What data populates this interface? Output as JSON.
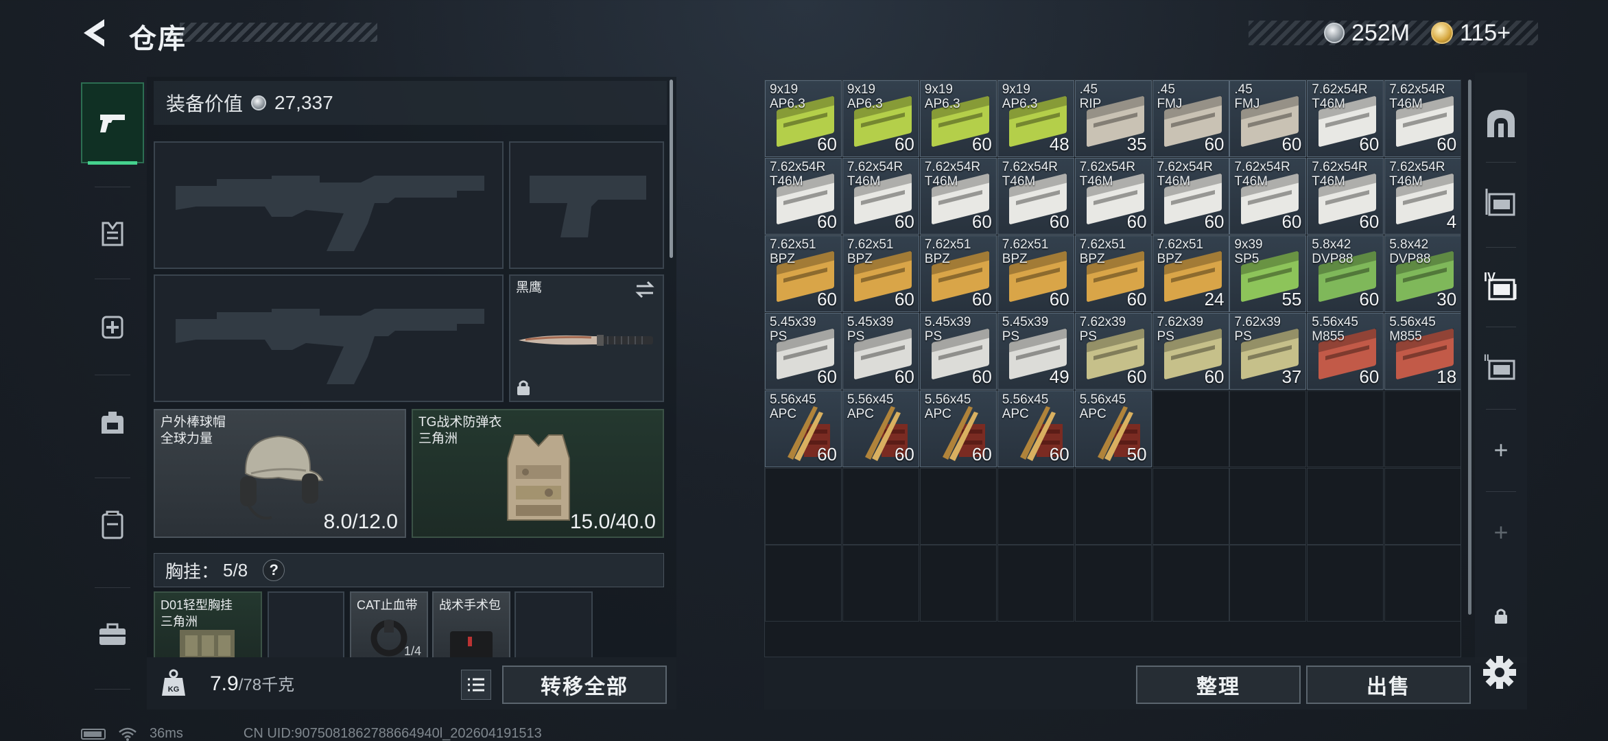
{
  "header": {
    "title": "仓库",
    "silver": "252M",
    "gold": "115+",
    "back_icon": "chevron-left-icon"
  },
  "categories": [
    {
      "name": "pistol",
      "icon": "pistol-icon",
      "active": true
    },
    {
      "name": "armor",
      "icon": "armor-icon",
      "active": false
    },
    {
      "name": "medical",
      "icon": "medkit-icon",
      "active": false
    },
    {
      "name": "backpack",
      "icon": "backpack-icon",
      "active": false
    },
    {
      "name": "container",
      "icon": "container-icon",
      "active": false
    },
    {
      "name": "toolbox",
      "icon": "toolbox-icon",
      "active": false
    }
  ],
  "equipment": {
    "value_label": "装备价值",
    "value": "27,337",
    "knife": {
      "name": "黑鹰"
    },
    "helmet": {
      "name": "户外棒球帽",
      "sub": "全球力量",
      "durability": "8.0/12.0"
    },
    "vest": {
      "name": "TG战术防弹衣",
      "sub": "三角洲",
      "durability": "15.0/40.0"
    },
    "chest": {
      "label": "胸挂：",
      "count": "5/8",
      "help": "?"
    },
    "chest_items": [
      {
        "name": "D01轻型胸挂",
        "sub": "三角洲"
      },
      {
        "name": ""
      },
      {
        "name": "CAT止血带",
        "count": "1/4"
      },
      {
        "name": "战术手术包"
      },
      {
        "name": ""
      }
    ],
    "weight_value": "7.9",
    "weight_max": "/78千克",
    "transfer_all": "转移全部"
  },
  "stash": {
    "columns": 9,
    "rows": 7,
    "items": [
      {
        "cal1": "9x19",
        "cal2": "AP6.3",
        "qty": "60",
        "color": "#b4cf4a"
      },
      {
        "cal1": "9x19",
        "cal2": "AP6.3",
        "qty": "60",
        "color": "#b4cf4a"
      },
      {
        "cal1": "9x19",
        "cal2": "AP6.3",
        "qty": "60",
        "color": "#b4cf4a"
      },
      {
        "cal1": "9x19",
        "cal2": "AP6.3",
        "qty": "48",
        "color": "#b4cf4a"
      },
      {
        "cal1": ".45",
        "cal2": "RIP",
        "qty": "35",
        "color": "#c9c2b4"
      },
      {
        "cal1": ".45",
        "cal2": "FMJ",
        "qty": "60",
        "color": "#c9c2b4"
      },
      {
        "cal1": ".45",
        "cal2": "FMJ",
        "qty": "60",
        "color": "#c9c2b4"
      },
      {
        "cal1": "7.62x54R",
        "cal2": "T46M",
        "qty": "60",
        "color": "#e8e8e4"
      },
      {
        "cal1": "7.62x54R",
        "cal2": "T46M",
        "qty": "60",
        "color": "#e8e8e4"
      },
      {
        "cal1": "7.62x54R",
        "cal2": "T46M",
        "qty": "60",
        "color": "#e8e8e4"
      },
      {
        "cal1": "7.62x54R",
        "cal2": "T46M",
        "qty": "60",
        "color": "#e8e8e4"
      },
      {
        "cal1": "7.62x54R",
        "cal2": "T46M",
        "qty": "60",
        "color": "#e8e8e4"
      },
      {
        "cal1": "7.62x54R",
        "cal2": "T46M",
        "qty": "60",
        "color": "#e8e8e4"
      },
      {
        "cal1": "7.62x54R",
        "cal2": "T46M",
        "qty": "60",
        "color": "#e8e8e4"
      },
      {
        "cal1": "7.62x54R",
        "cal2": "T46M",
        "qty": "60",
        "color": "#e8e8e4"
      },
      {
        "cal1": "7.62x54R",
        "cal2": "T46M",
        "qty": "60",
        "color": "#e8e8e4"
      },
      {
        "cal1": "7.62x54R",
        "cal2": "T46M",
        "qty": "60",
        "color": "#e8e8e4"
      },
      {
        "cal1": "7.62x54R",
        "cal2": "T46M",
        "qty": "4",
        "color": "#e8e8e4"
      },
      {
        "cal1": "7.62x51",
        "cal2": "BPZ",
        "qty": "60",
        "color": "#d9a548"
      },
      {
        "cal1": "7.62x51",
        "cal2": "BPZ",
        "qty": "60",
        "color": "#d9a548"
      },
      {
        "cal1": "7.62x51",
        "cal2": "BPZ",
        "qty": "60",
        "color": "#d9a548"
      },
      {
        "cal1": "7.62x51",
        "cal2": "BPZ",
        "qty": "60",
        "color": "#d9a548"
      },
      {
        "cal1": "7.62x51",
        "cal2": "BPZ",
        "qty": "60",
        "color": "#d9a548"
      },
      {
        "cal1": "7.62x51",
        "cal2": "BPZ",
        "qty": "24",
        "color": "#d9a548"
      },
      {
        "cal1": "9x39",
        "cal2": "SP5",
        "qty": "55",
        "color": "#8dc45a"
      },
      {
        "cal1": "5.8x42",
        "cal2": "DVP88",
        "qty": "60",
        "color": "#7fb85a"
      },
      {
        "cal1": "5.8x42",
        "cal2": "DVP88",
        "qty": "30",
        "color": "#7fb85a"
      },
      {
        "cal1": "5.45x39",
        "cal2": "PS",
        "qty": "60",
        "color": "#dcdcd8"
      },
      {
        "cal1": "5.45x39",
        "cal2": "PS",
        "qty": "60",
        "color": "#dcdcd8"
      },
      {
        "cal1": "5.45x39",
        "cal2": "PS",
        "qty": "60",
        "color": "#dcdcd8"
      },
      {
        "cal1": "5.45x39",
        "cal2": "PS",
        "qty": "49",
        "color": "#dcdcd8"
      },
      {
        "cal1": "7.62x39",
        "cal2": "PS",
        "qty": "60",
        "color": "#c6c08a"
      },
      {
        "cal1": "7.62x39",
        "cal2": "PS",
        "qty": "60",
        "color": "#c6c08a"
      },
      {
        "cal1": "7.62x39",
        "cal2": "PS",
        "qty": "37",
        "color": "#c6c08a"
      },
      {
        "cal1": "5.56x45",
        "cal2": "M855",
        "qty": "60",
        "color": "#c25a48"
      },
      {
        "cal1": "5.56x45",
        "cal2": "M855",
        "qty": "18",
        "color": "#c25a48"
      },
      {
        "cal1": "5.56x45",
        "cal2": "APC",
        "qty": "60",
        "color": "#b0833a",
        "bullets": true
      },
      {
        "cal1": "5.56x45",
        "cal2": "APC",
        "qty": "60",
        "color": "#b0833a",
        "bullets": true
      },
      {
        "cal1": "5.56x45",
        "cal2": "APC",
        "qty": "60",
        "color": "#b0833a",
        "bullets": true
      },
      {
        "cal1": "5.56x45",
        "cal2": "APC",
        "qty": "60",
        "color": "#b0833a",
        "bullets": true
      },
      {
        "cal1": "5.56x45",
        "cal2": "APC",
        "qty": "50",
        "color": "#b0833a",
        "bullets": true
      }
    ],
    "sort_label": "整理",
    "sell_label": "出售"
  },
  "sidebar": [
    {
      "name": "safe-box",
      "icon": "safe-icon"
    },
    {
      "name": "storage-1",
      "icon": "storage-icon"
    },
    {
      "name": "storage-4",
      "icon": "storage-iv-icon",
      "label": "IV"
    },
    {
      "name": "storage-2",
      "icon": "storage-icon"
    },
    {
      "name": "add-1",
      "icon": "plus-icon",
      "label": "+"
    },
    {
      "name": "add-2",
      "icon": "plus-icon",
      "label": "+"
    },
    {
      "name": "lock",
      "icon": "lock-icon"
    }
  ],
  "status": {
    "ping": "36ms",
    "uid": "CN UID:9075081862788664940l_202604191513"
  }
}
